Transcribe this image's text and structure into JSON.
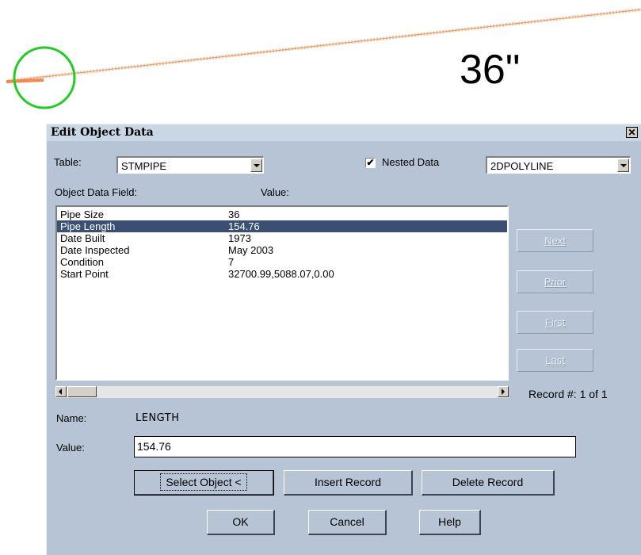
{
  "canvas": {
    "dimension_label": "36\""
  },
  "dialog": {
    "title": "Edit Object Data",
    "close_glyph": "✕",
    "table_label": "Table:",
    "table_value": "STMPIPE",
    "nested_checked_glyph": "✔",
    "nested_label": "Nested Data",
    "nested_checked": true,
    "object_type_value": "2DPOLYLINE",
    "field_header": "Object Data Field:",
    "value_header": "Value:",
    "rows": [
      {
        "field": "Pipe Size",
        "value": "36"
      },
      {
        "field": "Pipe Length",
        "value": "154.76"
      },
      {
        "field": "Date Built",
        "value": "1973"
      },
      {
        "field": "Date Inspected",
        "value": "May 2003"
      },
      {
        "field": "Condition",
        "value": "7"
      },
      {
        "field": "Start Point",
        "value": "32700.99,5088.07,0.00"
      }
    ],
    "selected_row": 1,
    "nav": {
      "next": "Next",
      "prior": "Prior",
      "first": "First",
      "last": "Last"
    },
    "record_counter": "Record #: 1 of 1",
    "name_label": "Name:",
    "name_value": "LENGTH",
    "value_label": "Value:",
    "value_input": "154.76",
    "buttons": {
      "select_object": "Select Object <",
      "insert_record": "Insert Record",
      "delete_record": "Delete Record",
      "ok": "OK",
      "cancel": "Cancel",
      "help": "Help"
    }
  },
  "colors": {
    "dialog_bg": "#b6c4d6",
    "selection": "#3a4f73",
    "marker_circle": "#22cc22",
    "pipe_line": "#e07a40"
  }
}
